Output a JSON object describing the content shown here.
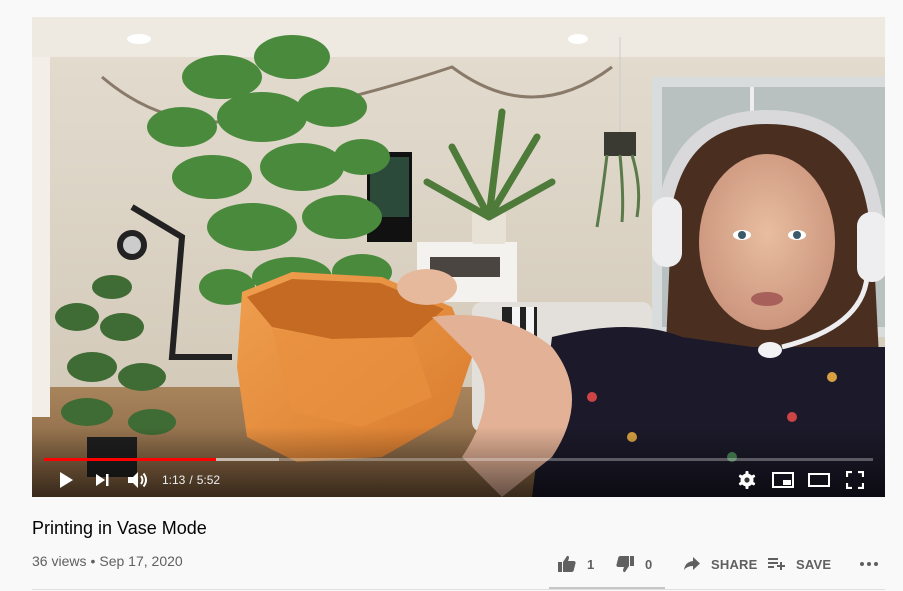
{
  "video": {
    "title": "Printing in Vase Mode",
    "views": "36 views",
    "separator": "•",
    "date": "Sep 17, 2020"
  },
  "player": {
    "current_time": "1:13",
    "time_separator": "/",
    "duration": "5:52",
    "progress_fraction": 0.207,
    "buffered_fraction": 0.283,
    "progress_color": "#ff0000"
  },
  "actions": {
    "like_count": "1",
    "dislike_count": "0",
    "share_label": "SHARE",
    "save_label": "SAVE"
  },
  "icons": {
    "play": "play-icon",
    "next": "next-icon",
    "volume": "volume-icon",
    "settings": "gear-icon",
    "miniplayer": "miniplayer-icon",
    "theater": "theater-mode-icon",
    "fullscreen": "fullscreen-icon",
    "like": "thumbs-up-icon",
    "dislike": "thumbs-down-icon",
    "share": "share-arrow-icon",
    "save": "playlist-add-icon",
    "more": "more-horizontal-icon"
  }
}
